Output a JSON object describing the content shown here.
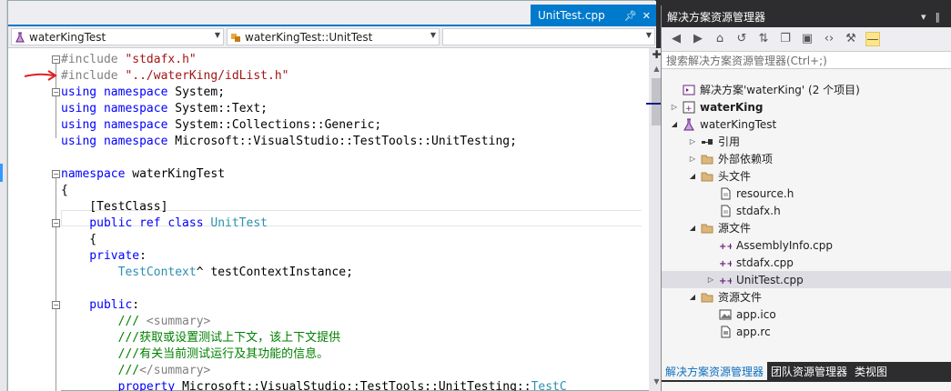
{
  "document_tab": {
    "label": "UnitTest.cpp"
  },
  "navigation": {
    "project_combo": "waterKingTest",
    "scope_combo": "waterKingTest::UnitTest",
    "member_combo": ""
  },
  "code_lines": [
    [
      {
        "t": "#include ",
        "c": "pp"
      },
      {
        "t": "\"stdafx.h\"",
        "c": "str"
      }
    ],
    [
      {
        "t": "#include ",
        "c": "pp"
      },
      {
        "t": "\"../waterKing/idList.h\"",
        "c": "str"
      }
    ],
    [
      {
        "t": "using ",
        "c": "kw"
      },
      {
        "t": "namespace ",
        "c": "kw"
      },
      {
        "t": "System;",
        "c": "plain"
      }
    ],
    [
      {
        "t": "using ",
        "c": "kw"
      },
      {
        "t": "namespace ",
        "c": "kw"
      },
      {
        "t": "System::Text;",
        "c": "plain"
      }
    ],
    [
      {
        "t": "using ",
        "c": "kw"
      },
      {
        "t": "namespace ",
        "c": "kw"
      },
      {
        "t": "System::Collections::Generic;",
        "c": "plain"
      }
    ],
    [
      {
        "t": "using ",
        "c": "kw"
      },
      {
        "t": "namespace ",
        "c": "kw"
      },
      {
        "t": "Microsoft::VisualStudio::TestTools::UnitTesting;",
        "c": "plain"
      }
    ],
    [],
    [
      {
        "t": "namespace ",
        "c": "kw"
      },
      {
        "t": "waterKingTest",
        "c": "plain"
      }
    ],
    [
      {
        "t": "{",
        "c": "plain"
      }
    ],
    [
      {
        "t": "    [TestClass]",
        "c": "plain"
      }
    ],
    [
      {
        "t": "    public ",
        "c": "kw"
      },
      {
        "t": "ref ",
        "c": "kw"
      },
      {
        "t": "class ",
        "c": "kw"
      },
      {
        "t": "UnitTest",
        "c": "type"
      }
    ],
    [
      {
        "t": "    {",
        "c": "plain"
      }
    ],
    [
      {
        "t": "    private",
        "c": "kw"
      },
      {
        "t": ":",
        "c": "plain"
      }
    ],
    [
      {
        "t": "        TestContext",
        "c": "type"
      },
      {
        "t": "^ testContextInstance;",
        "c": "plain"
      }
    ],
    [],
    [
      {
        "t": "    public",
        "c": "kw"
      },
      {
        "t": ":",
        "c": "plain"
      }
    ],
    [
      {
        "t": "        /// ",
        "c": "cm"
      },
      {
        "t": "<summary>",
        "c": "xml"
      }
    ],
    [
      {
        "t": "        ///获取或设置测试上下文，该上下文提供",
        "c": "cm"
      }
    ],
    [
      {
        "t": "        ///有关当前测试运行及其功能的信息。",
        "c": "cm"
      }
    ],
    [
      {
        "t": "        ///",
        "c": "cm"
      },
      {
        "t": "</summary>",
        "c": "xml"
      }
    ],
    [
      {
        "t": "        property ",
        "c": "kw"
      },
      {
        "t": "Microsoft::VisualStudio::TestTools::UnitTesting::",
        "c": "plain"
      },
      {
        "t": "TestC",
        "c": "type"
      }
    ]
  ],
  "solution_explorer": {
    "title": "解决方案资源管理器",
    "search_placeholder": "搜索解决方案资源管理器(Ctrl+;)",
    "tree": [
      {
        "label": "解决方案'waterKing' (2 个项目)",
        "bold": false
      },
      {
        "label": "waterKing",
        "bold": true
      },
      {
        "label": "waterKingTest",
        "bold": false
      },
      {
        "label": "引用",
        "bold": false
      },
      {
        "label": "外部依赖项",
        "bold": false
      },
      {
        "label": "头文件",
        "bold": false
      },
      {
        "label": "resource.h",
        "bold": false
      },
      {
        "label": "stdafx.h",
        "bold": false
      },
      {
        "label": "源文件",
        "bold": false
      },
      {
        "label": "AssemblyInfo.cpp",
        "bold": false
      },
      {
        "label": "stdafx.cpp",
        "bold": false
      },
      {
        "label": "UnitTest.cpp",
        "bold": false
      },
      {
        "label": "资源文件",
        "bold": false
      },
      {
        "label": "app.ico",
        "bold": false
      },
      {
        "label": "app.rc",
        "bold": false
      }
    ],
    "bottom_tabs": [
      {
        "label": "解决方案资源管理器",
        "active": true
      },
      {
        "label": "团队资源管理器",
        "active": false
      },
      {
        "label": "类视图",
        "active": false
      }
    ]
  },
  "colors": {
    "accent": "#007acc",
    "keyword": "#0000ff",
    "string": "#a31515",
    "comment": "#008000",
    "type": "#2b91af",
    "preprocessor": "#808080"
  }
}
